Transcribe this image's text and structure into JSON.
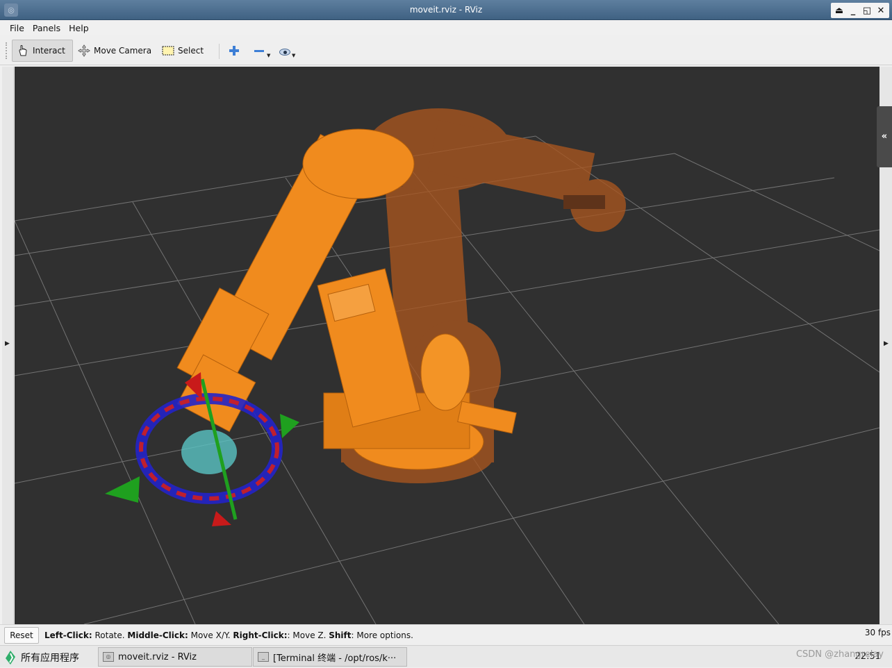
{
  "window": {
    "title": "moveit.rviz - RViz",
    "app_icon": "rviz-icon"
  },
  "menubar": {
    "items": [
      "File",
      "Panels",
      "Help"
    ]
  },
  "toolbar": {
    "tools": [
      {
        "label": "Interact",
        "icon": "hand-pointer-icon",
        "active": true
      },
      {
        "label": "Move Camera",
        "icon": "move-camera-icon",
        "active": false
      },
      {
        "label": "Select",
        "icon": "select-rect-icon",
        "active": false
      }
    ],
    "icons": [
      "add-tool-icon",
      "remove-tool-icon",
      "visibility-eye-icon"
    ]
  },
  "statusbar": {
    "reset_label": "Reset",
    "hint": [
      {
        "bold": "Left-Click:",
        "text": " Rotate. "
      },
      {
        "bold": "Middle-Click:",
        "text": " Move X/Y. "
      },
      {
        "bold": "Right-Click:",
        "text": ": Move Z. "
      },
      {
        "bold": "Shift",
        "text": ": More options."
      }
    ],
    "fps": "30 fps"
  },
  "taskbar": {
    "start_label": "所有应用程序",
    "tasks": [
      {
        "label": "moveit.rviz - RViz"
      },
      {
        "label": "[Terminal 终端 - /opt/ros/k···"
      }
    ],
    "clock": "22:51",
    "watermark": "CSDN @zhangrelay"
  },
  "colors": {
    "viewport_bg": "#303030",
    "robot_orange": "#f08b1e",
    "ghost_orange": "#a9561f",
    "titlebar": "#4a6d90"
  }
}
